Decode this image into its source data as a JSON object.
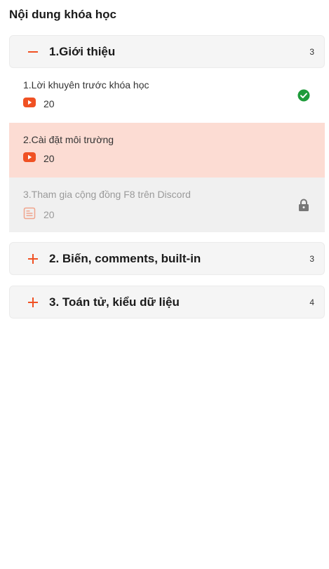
{
  "page": {
    "title": "Nội dung khóa học"
  },
  "colors": {
    "accent": "#f05123",
    "active_bg": "#fcdcd3",
    "locked_bg": "#f0f0f0",
    "done_green": "#1e9b3a"
  },
  "sections": [
    {
      "name": "1.Giới thiệu",
      "count": "3",
      "expanded": true,
      "toggle_icon": "minus-icon",
      "lessons": [
        {
          "title": "1.Lời khuyên trước khóa học",
          "duration": "20",
          "type_icon": "youtube-icon",
          "status_icon": "check-circle-icon",
          "state": "done"
        },
        {
          "title": "2.Cài đặt môi trường",
          "duration": "20",
          "type_icon": "youtube-icon",
          "status_icon": "",
          "state": "active"
        },
        {
          "title": "3.Tham gia cộng đồng F8 trên Discord",
          "duration": "20",
          "type_icon": "document-icon",
          "status_icon": "lock-icon",
          "state": "locked"
        }
      ]
    },
    {
      "name": "2. Biến, comments, built-in",
      "count": "3",
      "expanded": false,
      "toggle_icon": "plus-icon"
    },
    {
      "name": "3. Toán tử, kiểu dữ liệu",
      "count": "4",
      "expanded": false,
      "toggle_icon": "plus-icon"
    }
  ]
}
